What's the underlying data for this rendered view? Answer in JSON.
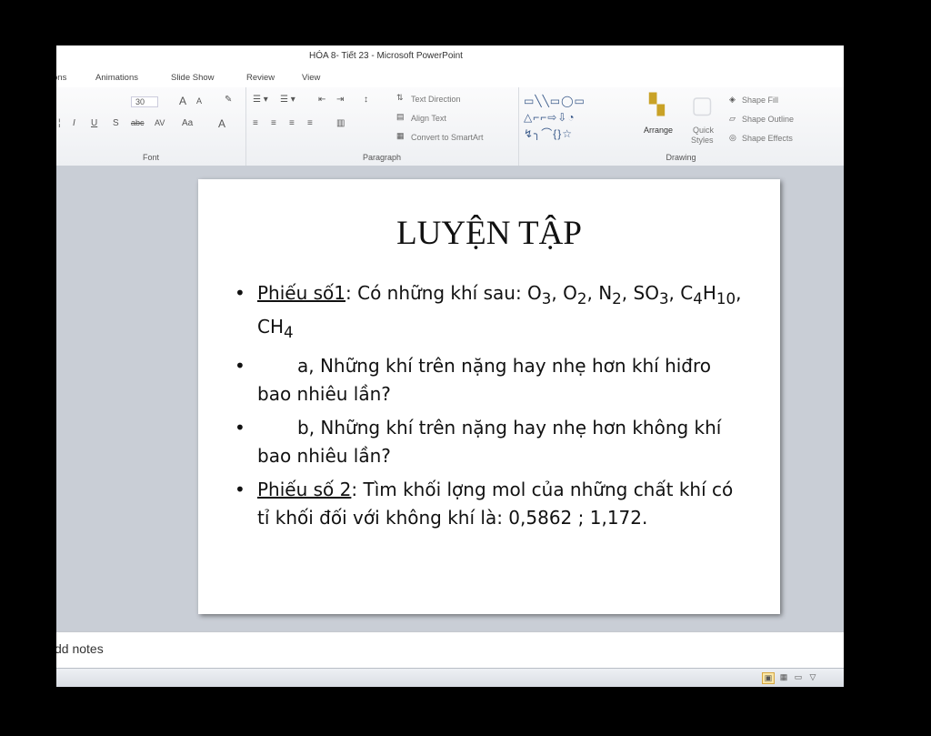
{
  "window": {
    "title": "HÓA 8- Tiết 23 - Microsoft PowerPoint"
  },
  "tabs": [
    "ons",
    "Animations",
    "Slide Show",
    "Review",
    "View"
  ],
  "ribbon": {
    "font": {
      "label": "Font",
      "size": "30",
      "grow": "A",
      "shrink": "A",
      "italic": "I",
      "underline": "U",
      "strike": "abc",
      "spacing": "AV",
      "case": "Aa",
      "color": "A"
    },
    "paragraph": {
      "label": "Paragraph",
      "text_direction": "Text Direction",
      "align_text": "Align Text",
      "convert_smartart": "Convert to SmartArt"
    },
    "drawing": {
      "label": "Drawing",
      "arrange": "Arrange",
      "quick_styles_1": "Quick",
      "quick_styles_2": "Styles",
      "shape_fill": "Shape Fill",
      "shape_outline": "Shape Outline",
      "shape_effects": "Shape Effects"
    }
  },
  "slide": {
    "title": "LUYỆN TẬP",
    "b1": {
      "label": "Phiếu số1",
      "t1": ": Có những khí sau: O",
      "s1": "3",
      "t2": ", O",
      "s2": "2",
      "t3": ", N",
      "s3": "2",
      "t4": ", SO",
      "s4": "3",
      "t5": ", C",
      "s5": "4",
      "t6": "H",
      "s6": "10",
      "t7": ", CH",
      "s7": "4"
    },
    "b2": "a, Những khí trên nặng hay nhẹ hơn khí hiđro bao nhiêu lần?",
    "b3": "b, Những khí trên nặng hay nhẹ hơn không khí bao nhiêu lần?",
    "b4": {
      "label": "Phiếu số 2",
      "text": ": Tìm khối lợng mol của những chất khí có tỉ khối đối với không khí là:  0,5862 ; 1,172."
    }
  },
  "notes": {
    "placeholder": "dd notes"
  }
}
